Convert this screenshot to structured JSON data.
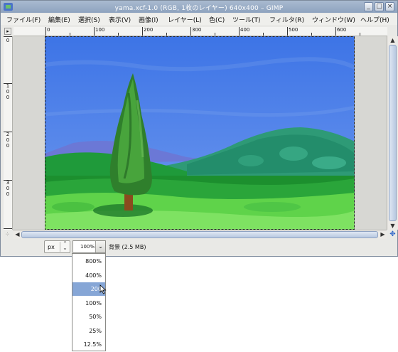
{
  "window": {
    "title": "yama.xcf-1.0 (RGB, 1枚のレイヤー) 640x400 – GIMP",
    "buttons": {
      "minimize": "_",
      "maximize": "□",
      "close": "×"
    }
  },
  "menubar": {
    "items": [
      "ファイル(F)",
      "編集(E)",
      "選択(S)",
      "表示(V)",
      "画像(I)",
      "レイヤー(L)",
      "色(C)",
      "ツール(T)",
      "フィルタ(R)",
      "ウィンドウ(W)",
      "ヘルプ(H)"
    ]
  },
  "ruler": {
    "horizontal_labels": [
      "0",
      "100",
      "200",
      "300",
      "400",
      "500",
      "600"
    ],
    "vertical_labels": [
      [
        "1",
        "0",
        "0"
      ],
      [
        "2",
        "0",
        "0"
      ],
      [
        "3",
        "0",
        "0"
      ]
    ],
    "vertical_zero": "0"
  },
  "statusbar": {
    "unit": "px",
    "zoom_value": "100%",
    "layer_info": "背景 (2.5 MB)"
  },
  "zoom_dropdown": {
    "options": [
      "800%",
      "400%",
      "200",
      "100%",
      "50%",
      "25%",
      "12.5%"
    ],
    "highlighted_index": 2
  },
  "icons": {
    "app": "gimp-app-icon",
    "nav": "navigation-cross-icon",
    "quickmask": "quick-mask-icon",
    "pointer": "mouse-pointer-icon"
  },
  "colors": {
    "titlebar": "#9db0ca",
    "dropdown_highlight": "#86a6d6",
    "sky": "#4a7de8"
  }
}
